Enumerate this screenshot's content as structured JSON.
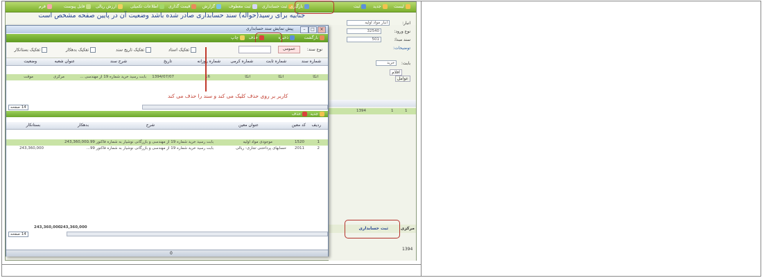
{
  "topbar": {
    "items": [
      {
        "label": "ثبت حسابداری",
        "icon": "ledger-icon",
        "color": "#e1b844"
      },
      {
        "label": "ثبت معطوف",
        "icon": "link-icon",
        "color": "#d6d6f7"
      },
      {
        "label": "گزارش",
        "icon": "report-icon",
        "color": "#7cc3e6"
      },
      {
        "label": "قیمت گذاری",
        "icon": "price-icon",
        "color": "#e88b5b"
      },
      {
        "label": "اطلاعات تکمیلی",
        "icon": "info-icon",
        "color": "#a3d86a"
      },
      {
        "label": "ارزش ریالی",
        "icon": "money-icon",
        "color": "#f0d060"
      },
      {
        "label": "فایل پیوست",
        "icon": "attach-icon",
        "color": "#c8e08a"
      },
      {
        "label": "فرم",
        "icon": "form-icon",
        "color": "#f4a9a9"
      },
      {
        "label": "بارگیری",
        "icon": "download-icon",
        "color": "#6a9bd8"
      },
      {
        "label": "جدید",
        "icon": "new-icon",
        "color": "#f2c24e"
      },
      {
        "label": "ثبت",
        "icon": "save-icon",
        "color": "#5b8fd8"
      },
      {
        "label": "لیست",
        "icon": "list-icon",
        "color": "#f2c24e"
      }
    ]
  },
  "title_note": "جنابیه برای رسید(حواله) سند حسابداری صادر شده باشد وضعیت آن در پایین صفحه مشخص است",
  "right_panel": {
    "labels": [
      "انبار:",
      "نوع ورود:",
      "سند مبدا:",
      "توضیحات:",
      "بابت:",
      "خرید",
      "اقلام",
      "عوامل"
    ],
    "fields": [
      "انبار مواد اولیه",
      "32540",
      "501",
      "1394/07/07"
    ],
    "row_values": [
      "1394",
      "1",
      "1"
    ],
    "bottom_status": "ثبت حسابداری",
    "bottom_status_extra": "مرکزی",
    "bottom_year": "1394"
  },
  "dialog": {
    "title": "پیش نمایش سند حسابداری",
    "toolbar": {
      "delete": "حذف",
      "save": "ذخیره",
      "print": "چاپ",
      "back": "بازگشت"
    },
    "filter": {
      "doc_type_label": "نوع سند:",
      "doc_type_value": "عمومی",
      "checks": [
        "تفکیک اسناد",
        "تفکیک تاریخ سند",
        "تفکیک بدهکار",
        "تفکیک بستانکار"
      ]
    },
    "upper_grid": {
      "headers": [
        "شماره سند",
        "شماره ثابت",
        "شماره کرمی",
        "شماره روزانه",
        "تاریخ",
        "شرح سند",
        "عنوان شعبه",
        "وضعیت"
      ],
      "row": [
        "اتکا",
        "اتکا",
        "اتکا",
        "16",
        "1394/07/07",
        "بابت رسید خرید شماره 19 از مهندسی ...",
        "مرکزی",
        "موقت"
      ]
    },
    "annotation": "کاربر بر روی حذف کلیک می کند و سند را حذف می کند",
    "pager": {
      "page": "14",
      "of": "صفحه"
    },
    "lower_toolbar": {
      "new": "جدید",
      "delete": "حذف"
    },
    "lower_grid": {
      "headers": [
        "ردیف",
        "کد معین",
        "عنوان معین",
        "شرح",
        "بدهکار",
        "بستانکار"
      ],
      "rows": [
        [
          "1",
          "1520",
          "موجودی مواد اولیه",
          "بابت رسید خرید شماره 19 از مهندسی و بازرگانی نوشیار به شماره فاکتور 99...",
          "243,360,000",
          ""
        ],
        [
          "2",
          "2011",
          "حسابهای پرداختنی تجاری- ریالی",
          "بابت رسید خرید شماره 19 از مهندسی و بازرگانی نوشیار به شماره فاکتور 99...",
          "",
          "243,360,000"
        ]
      ],
      "totals": [
        "243,360,000",
        "243,360,000"
      ],
      "footer_value": "0"
    }
  }
}
